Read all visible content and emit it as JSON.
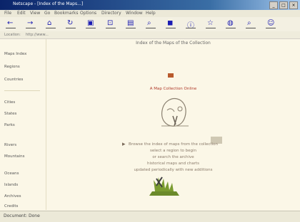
{
  "window": {
    "title": "Netscape - [Index of the Maps...]",
    "buttons": [
      "_",
      "□",
      "×"
    ]
  },
  "menubar": {
    "items": [
      "File",
      "Edit",
      "View",
      "Go",
      "Bookmarks",
      "Options",
      "Directory",
      "Window",
      "Help"
    ]
  },
  "toolbar": {
    "buttons": [
      {
        "label": "Back",
        "icon": "arrow-back-icon"
      },
      {
        "label": "Forward",
        "icon": "arrow-forward-icon"
      },
      {
        "label": "Home",
        "icon": "home-icon"
      },
      {
        "label": "Reload",
        "icon": "reload-icon"
      },
      {
        "label": "Images",
        "icon": "image-icon"
      },
      {
        "label": "Open",
        "icon": "open-icon"
      },
      {
        "label": "Print",
        "icon": "print-icon"
      },
      {
        "label": "Find",
        "icon": "find-icon"
      },
      {
        "label": "Stop",
        "icon": "stop-icon"
      },
      {
        "label": "What's New",
        "icon": "info-icon"
      },
      {
        "label": "What's Cool",
        "icon": "star-icon"
      },
      {
        "label": "Destinations",
        "icon": "globe-icon"
      },
      {
        "label": "Net Search",
        "icon": "search-icon"
      },
      {
        "label": "People",
        "icon": "people-icon"
      }
    ]
  },
  "address": {
    "label": "Location:",
    "value": "http://www..."
  },
  "sidebar": {
    "items": [
      "Maps Index",
      "Regions",
      "Countries",
      "Cities",
      "States",
      "Parks",
      "Rivers",
      "Mountains",
      "Oceans",
      "Islands",
      "Archives",
      "Credits"
    ]
  },
  "main": {
    "page_title": "Index of the Maps of the Collection",
    "red_line": "A Map Collection Online",
    "caption_lines": [
      "Browse the index of maps from the collection",
      "select a region to begin",
      "or search the archive",
      "historical maps and charts",
      "updated periodically with new additions"
    ]
  },
  "status": {
    "left": "Document: Done",
    "right": ""
  }
}
